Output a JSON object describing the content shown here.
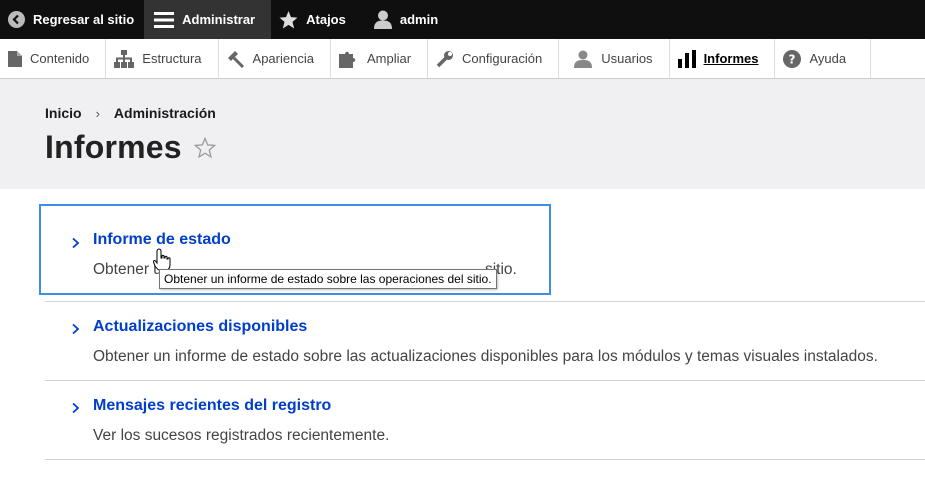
{
  "toolbar": {
    "back_label": "Regresar al sitio",
    "manage_label": "Administrar",
    "shortcuts_label": "Atajos",
    "user_label": "admin"
  },
  "tray": {
    "items": [
      {
        "label": "Contenido",
        "icon": "document-icon"
      },
      {
        "label": "Estructura",
        "icon": "sitemap-icon"
      },
      {
        "label": "Apariencia",
        "icon": "paintbrush-icon"
      },
      {
        "label": "Ampliar",
        "icon": "puzzle-icon"
      },
      {
        "label": "Configuración",
        "icon": "wrench-icon"
      },
      {
        "label": "Usuarios",
        "icon": "users-icon"
      },
      {
        "label": "Informes",
        "icon": "bar-chart-icon",
        "active": true
      },
      {
        "label": "Ayuda",
        "icon": "help-icon"
      }
    ]
  },
  "breadcrumb": {
    "home": "Inicio",
    "separator": "›",
    "admin": "Administración"
  },
  "page": {
    "title": "Informes"
  },
  "admin_items": [
    {
      "link": "Informe de estado",
      "description": "Obtener un informe de estado sobre las operaciones del sitio.",
      "desc_visible_start": "Obtener u",
      "desc_visible_end": "sitio."
    },
    {
      "link": "Actualizaciones disponibles",
      "description": "Obtener un informe de estado sobre las actualizaciones disponibles para los módulos y temas visuales instalados."
    },
    {
      "link": "Mensajes recientes del registro",
      "description": "Ver los sucesos registrados recientemente."
    }
  ],
  "tooltip": {
    "text": "Obtener un informe de estado sobre las operaciones del sitio."
  },
  "colors": {
    "toolbar_bg": "#0f0f0f",
    "link": "#003ecc",
    "focus": "#3d8fe5",
    "header_bg": "#f0f0f3"
  }
}
